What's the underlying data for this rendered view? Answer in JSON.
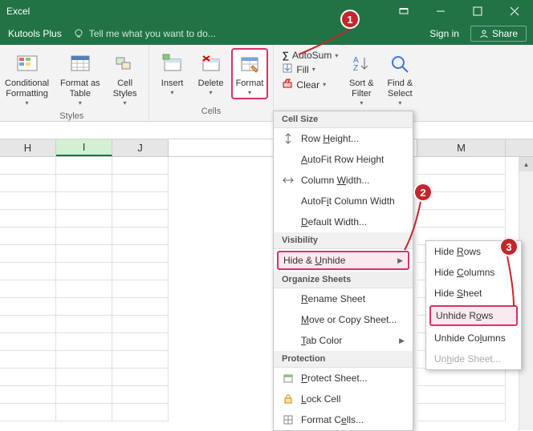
{
  "titlebar": {
    "title": "Excel"
  },
  "subbar": {
    "tab": "Kutools Plus",
    "tell": "Tell me what you want to do...",
    "signin": "Sign in",
    "share": "Share"
  },
  "ribbon": {
    "conditional": "Conditional\nFormatting",
    "formatAs": "Format as\nTable",
    "cellStyles": "Cell\nStyles",
    "stylesGroup": "Styles",
    "insert": "Insert",
    "delete": "Delete",
    "format": "Format",
    "cellsGroup": "Cells",
    "autosum": "AutoSum",
    "fill": "Fill",
    "clear": "Clear",
    "sortFilter": "Sort &\nFilter",
    "findSelect": "Find &\nSelect"
  },
  "columns": [
    "H",
    "I",
    "J",
    "M"
  ],
  "menu": {
    "cellSize": "Cell Size",
    "rowHeight": "Row Height...",
    "autofitRowHeight": "AutoFit Row Height",
    "columnWidth": "Column Width...",
    "autofitColWidth": "AutoFit Column Width",
    "defaultWidth": "Default Width...",
    "visibility": "Visibility",
    "hideUnhide": "Hide & Unhide",
    "organize": "Organize Sheets",
    "rename": "Rename Sheet",
    "moveCopy": "Move or Copy Sheet...",
    "tabColor": "Tab Color",
    "protection": "Protection",
    "protectSheet": "Protect Sheet...",
    "lockCell": "Lock Cell",
    "formatCells": "Format Cells..."
  },
  "submenu": {
    "hideRows": "Hide Rows",
    "hideCols": "Hide Columns",
    "hideSheet": "Hide Sheet",
    "unhideRows": "Unhide Rows",
    "unhideCols": "Unhide Columns",
    "unhideSheet": "Unhide Sheet..."
  },
  "annot": {
    "a1": "1",
    "a2": "2",
    "a3": "3"
  }
}
